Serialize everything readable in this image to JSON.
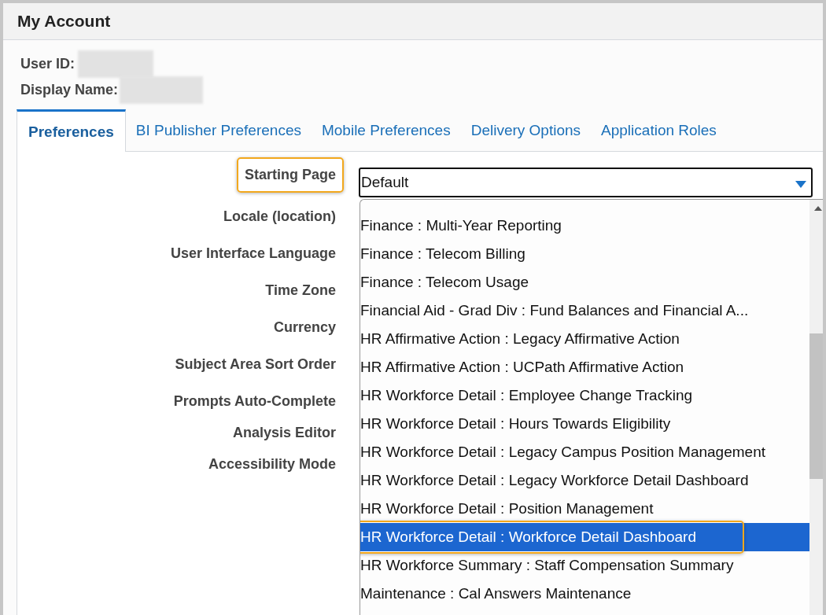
{
  "header": {
    "title": "My Account"
  },
  "identity": [
    {
      "label": "User ID:",
      "redacted": true
    },
    {
      "label": "Display Name:",
      "redacted": true
    }
  ],
  "tabs": [
    {
      "label": "Preferences",
      "selected": true
    },
    {
      "label": "BI Publisher Preferences",
      "selected": false
    },
    {
      "label": "Mobile Preferences",
      "selected": false
    },
    {
      "label": "Delivery Options",
      "selected": false
    },
    {
      "label": "Application Roles",
      "selected": false
    }
  ],
  "fields": [
    {
      "label": "Starting Page",
      "callout": true
    },
    {
      "label": "Locale (location)",
      "callout": false
    },
    {
      "label": "User Interface Language",
      "callout": false
    },
    {
      "label": "Time Zone",
      "callout": false
    },
    {
      "label": "Currency",
      "callout": false
    },
    {
      "label": "Subject Area Sort Order",
      "callout": false
    },
    {
      "label": "Prompts Auto-Complete",
      "callout": false
    },
    {
      "label": "Analysis Editor",
      "callout": false
    },
    {
      "label": "Accessibility Mode",
      "callout": false
    }
  ],
  "starting_page_select": {
    "value": "Default",
    "expanded": true
  },
  "dropdown_options": [
    {
      "label": "Finance : Multi-Year Reporting",
      "selected": false,
      "callout": false
    },
    {
      "label": "Finance : Telecom Billing",
      "selected": false,
      "callout": false
    },
    {
      "label": "Finance : Telecom Usage",
      "selected": false,
      "callout": false
    },
    {
      "label": "Financial Aid - Grad Div : Fund Balances and Financial A...",
      "selected": false,
      "callout": false
    },
    {
      "label": "HR Affirmative Action : Legacy Affirmative Action",
      "selected": false,
      "callout": false
    },
    {
      "label": "HR Affirmative Action : UCPath Affirmative Action",
      "selected": false,
      "callout": false
    },
    {
      "label": "HR Workforce Detail : Employee Change Tracking",
      "selected": false,
      "callout": false
    },
    {
      "label": "HR Workforce Detail : Hours Towards Eligibility",
      "selected": false,
      "callout": false
    },
    {
      "label": "HR Workforce Detail : Legacy Campus Position Management",
      "selected": false,
      "callout": false
    },
    {
      "label": "HR Workforce Detail : Legacy Workforce Detail Dashboard",
      "selected": false,
      "callout": false
    },
    {
      "label": "HR Workforce Detail : Position Management",
      "selected": false,
      "callout": false
    },
    {
      "label": "HR Workforce Detail : Workforce Detail Dashboard",
      "selected": true,
      "callout": true
    },
    {
      "label": "HR Workforce Summary : Staff Compensation Summary",
      "selected": false,
      "callout": false
    },
    {
      "label": "Maintenance : Cal Answers Maintenance",
      "selected": false,
      "callout": false
    }
  ]
}
